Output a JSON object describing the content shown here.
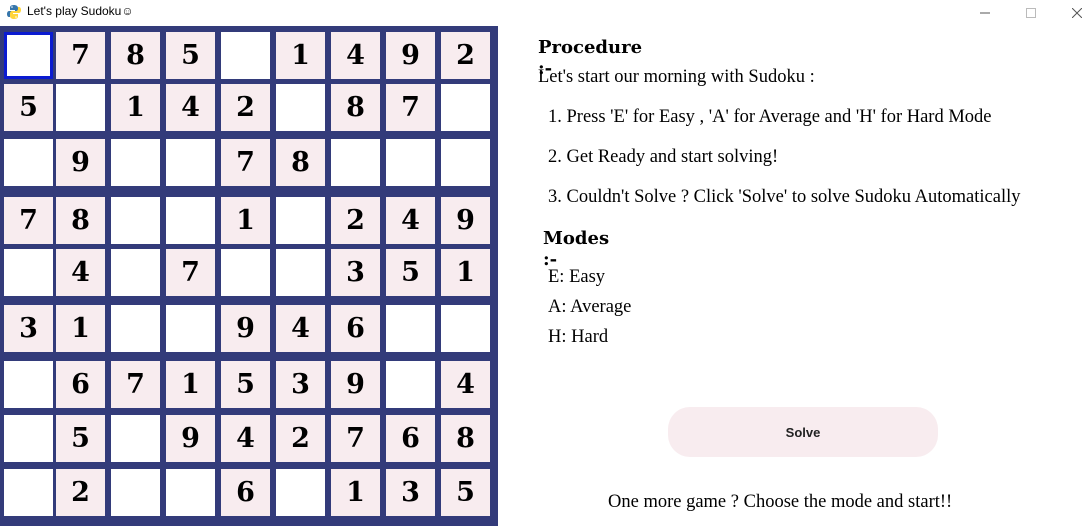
{
  "window": {
    "title": "Let's play Sudoku☺",
    "icon": "python-snake-icon"
  },
  "board": {
    "selected": [
      0,
      0
    ],
    "rows": [
      [
        "",
        "7",
        "8",
        "5",
        "",
        "1",
        "4",
        "9",
        "2"
      ],
      [
        "5",
        "",
        "1",
        "4",
        "2",
        "",
        "8",
        "7",
        ""
      ],
      [
        "",
        "9",
        "",
        "",
        "7",
        "8",
        "",
        "",
        ""
      ],
      [
        "7",
        "8",
        "",
        "",
        "1",
        "",
        "2",
        "4",
        "9"
      ],
      [
        "",
        "4",
        "",
        "7",
        "",
        "",
        "3",
        "5",
        "1"
      ],
      [
        "3",
        "1",
        "",
        "",
        "9",
        "4",
        "6",
        "",
        ""
      ],
      [
        "",
        "6",
        "7",
        "1",
        "5",
        "3",
        "9",
        "",
        "4"
      ],
      [
        "",
        "5",
        "",
        "9",
        "4",
        "2",
        "7",
        "6",
        "8"
      ],
      [
        "",
        "2",
        "",
        "",
        "6",
        "",
        "1",
        "3",
        "5"
      ]
    ],
    "colors": {
      "grid": "#333b7a",
      "given_cell": "#f8ecef",
      "empty_cell": "#ffffff",
      "selection": "#0b1bd1"
    }
  },
  "instructions": {
    "procedure_heading": "Procedure :-",
    "intro": "Let's start our morning with Sudoku :",
    "steps": [
      "1. Press 'E' for Easy , 'A' for Average and 'H' for Hard Mode",
      "2. Get Ready and start solving!",
      "3. Couldn't Solve ? Click 'Solve' to solve Sudoku Automatically"
    ],
    "modes_heading": "Modes :-",
    "modes": [
      "E: Easy",
      "A: Average",
      "H: Hard"
    ]
  },
  "solve_button": {
    "label": "Solve",
    "color": "#f8ecef"
  },
  "footer": "One more game ? Choose the mode and start!!"
}
